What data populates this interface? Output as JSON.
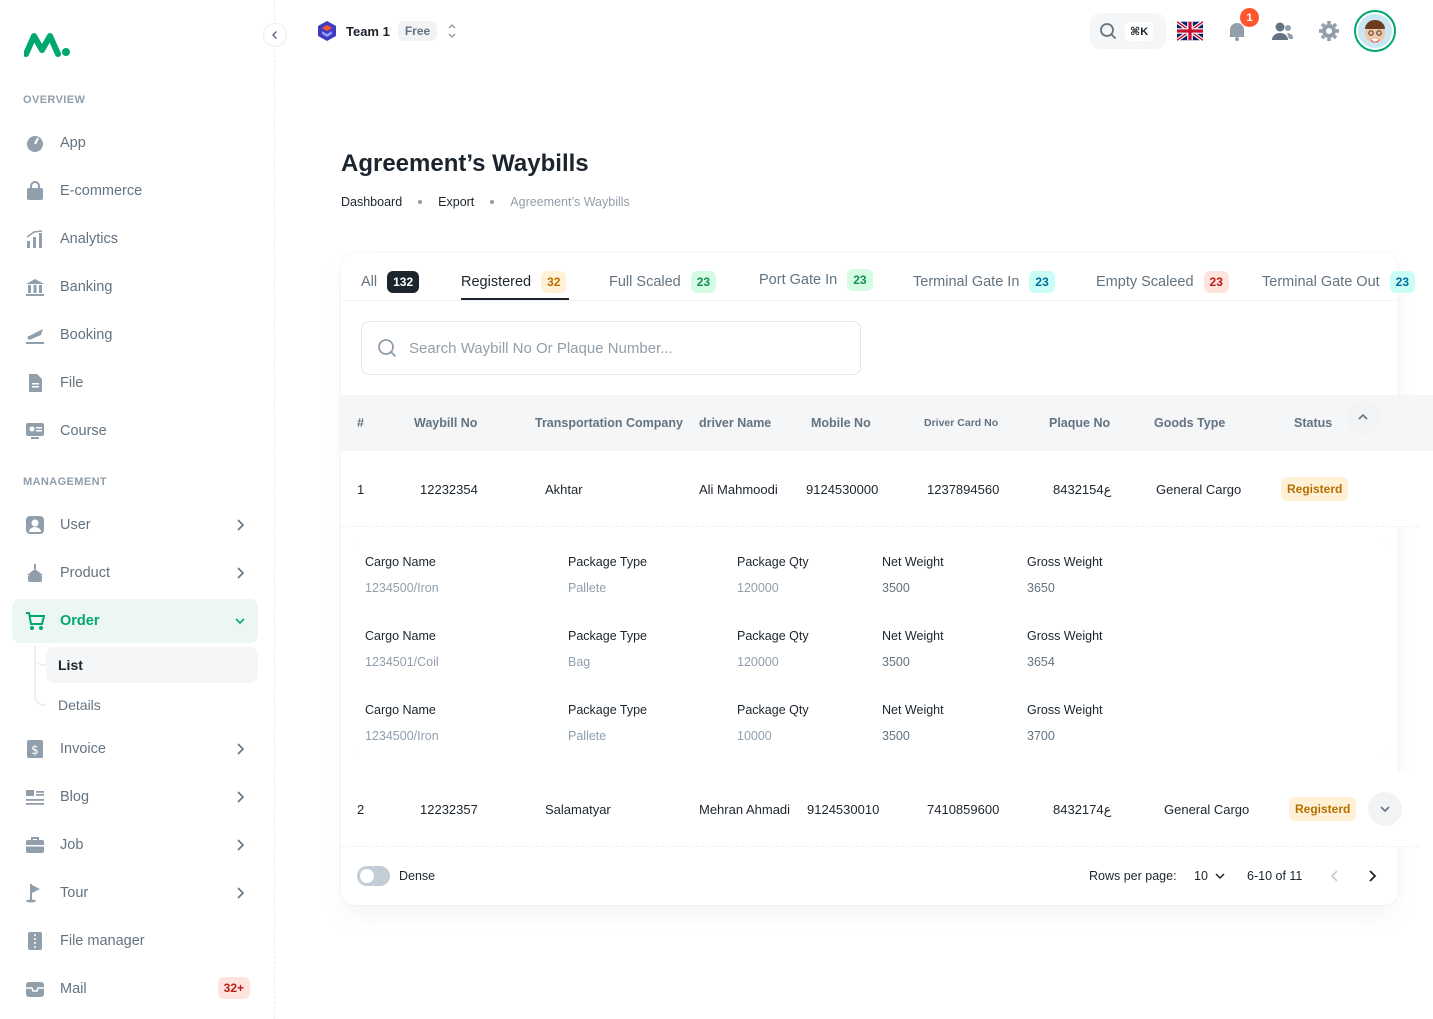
{
  "sidebar": {
    "overview_title": "OVERVIEW",
    "management_title": "MANAGEMENT",
    "overview_items": [
      "App",
      "E-commerce",
      "Analytics",
      "Banking",
      "Booking",
      "File",
      "Course"
    ],
    "management_items": [
      "User",
      "Product",
      "Order",
      "Invoice",
      "Blog",
      "Job",
      "Tour",
      "File manager",
      "Mail"
    ],
    "order_sub": [
      "List",
      "Details"
    ],
    "mail_badge": "32+"
  },
  "header": {
    "team": "Team 1",
    "plan": "Free",
    "shortcut": "⌘K",
    "notifications": "1"
  },
  "page": {
    "title": "Agreement’s  Waybills",
    "breadcrumb": [
      "Dashboard",
      "Export",
      "Agreement’s Waybills"
    ]
  },
  "tabs": [
    {
      "label": "All",
      "count": "132"
    },
    {
      "label": "Registered",
      "count": "32"
    },
    {
      "label": "Full Scaled",
      "count": "23"
    },
    {
      "label": "Port Gate In",
      "count": "23"
    },
    {
      "label": "Terminal Gate In",
      "count": "23"
    },
    {
      "label": "Empty Scaleed",
      "count": "23"
    },
    {
      "label": "Terminal Gate Out",
      "count": "23"
    }
  ],
  "search": {
    "placeholder": "Search Waybill No  Or Plaque Number..."
  },
  "table": {
    "headers": [
      "#",
      "Waybill No",
      "Transportation Company",
      "driver Name",
      "Mobile No",
      "Driver Card No",
      "Plaque No",
      "Goods Type",
      "Status"
    ],
    "rows": [
      [
        "1",
        "12232354",
        "Akhtar",
        "Ali Mahmoodi",
        "9124530000",
        "1237894560",
        "84ع32154",
        "General Cargo",
        "Registerd"
      ],
      [
        "2",
        "12232357",
        "Salamatyar",
        "Mehran Ahmadi",
        "9124530010",
        "7410859600",
        "84ع32174",
        "General Cargo",
        "Registerd"
      ]
    ]
  },
  "details": {
    "labels": [
      "Cargo Name",
      "Package Type",
      "Package Qty",
      "Net Weight",
      "Gross Weight"
    ],
    "rows": [
      [
        "1234500/Iron",
        "Pallete",
        "120000",
        "3500",
        "3650"
      ],
      [
        "1234501/Coil",
        "Bag",
        "120000",
        "3500",
        "3654"
      ],
      [
        "1234500/Iron",
        "Pallete",
        "10000",
        "3500",
        "3700"
      ]
    ]
  },
  "footer": {
    "dense": "Dense",
    "rows_per_page": "Rows per page:",
    "rows_value": "10",
    "range": "6-10 of 11"
  }
}
